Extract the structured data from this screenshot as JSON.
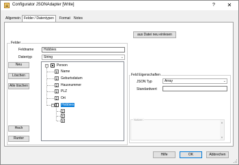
{
  "window": {
    "title": "Configurator JSONAdapter [Write]",
    "help_glyph": "?",
    "close_glyph": "✕"
  },
  "tabs": [
    {
      "label": "Allgemein",
      "active": false
    },
    {
      "label": "Felder / Datentypen",
      "active": true
    },
    {
      "label": "Format",
      "active": false
    },
    {
      "label": "Notes",
      "active": false
    }
  ],
  "toolbar": {
    "import_label": "aus Datei neu einlesen"
  },
  "felder": {
    "group_label": "Felder",
    "fieldname_label": "Feldname",
    "fieldname_value": "Hobbies",
    "datatype_label": "Datentyp",
    "datatype_value": "String",
    "buttons": {
      "new": "Neu",
      "delete": "Löschen",
      "delete_all": "Alle löschen",
      "up": "Hoch",
      "down": "Runter"
    }
  },
  "tree": {
    "root": "Person",
    "children": [
      "Name",
      "Geburtsdatum",
      "Hausnummer",
      "PLZ",
      "Ort"
    ],
    "array_node": "Hobbies",
    "array_children_count": 3,
    "expander_glyph": "−"
  },
  "properties": {
    "group_label": "Feld Eigenschaften",
    "json_type_label": "JSON Typ",
    "json_type_value": "Array",
    "default_label": "Standardwert",
    "default_value": "",
    "notes_label": "Notizen"
  },
  "footer": {
    "help": "Hilfe",
    "ok": "OK",
    "cancel": "Abbrechen"
  },
  "colors": {
    "selection": "#0078d7",
    "panel": "#ffffff",
    "chrome": "#f0f0f0"
  }
}
